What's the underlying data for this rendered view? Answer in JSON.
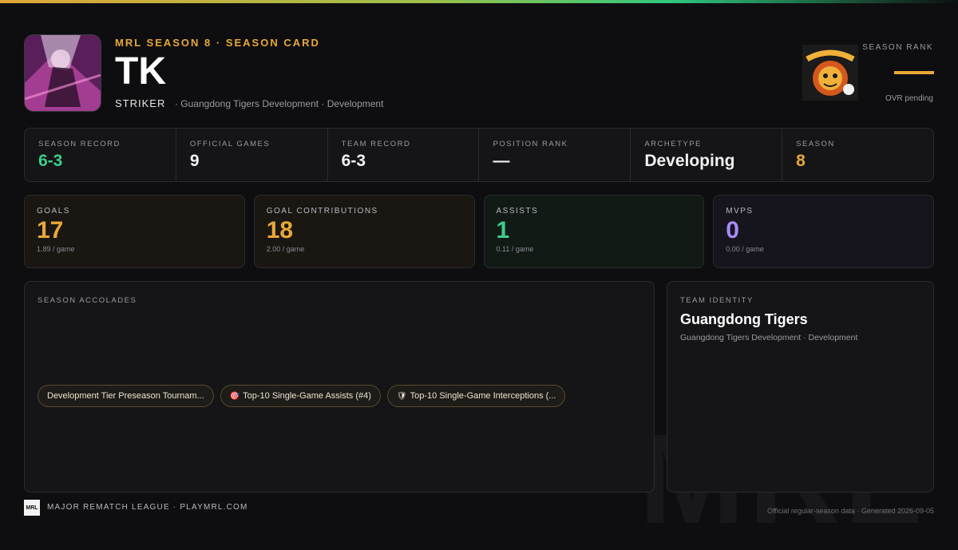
{
  "header": {
    "eyebrow": "MRL SEASON 8 · SEASON CARD",
    "player_name": "TK",
    "position": "STRIKER",
    "team_line": "· Guangdong Tigers Development · Development"
  },
  "rank": {
    "label": "SEASON RANK",
    "ovr_text": "OVR pending",
    "accent_color": "#e8a838"
  },
  "stats": [
    {
      "label": "SEASON RECORD",
      "value": "6-3",
      "color": "#3ccf8a"
    },
    {
      "label": "OFFICIAL GAMES",
      "value": "9",
      "color": "#f2f2f2"
    },
    {
      "label": "TEAM RECORD",
      "value": "6-3",
      "color": "#f2f2f2"
    },
    {
      "label": "POSITION RANK",
      "value": "—",
      "color": "#f2f2f2"
    },
    {
      "label": "ARCHETYPE",
      "value": "Developing",
      "color": "#f2f2f2"
    },
    {
      "label": "SEASON",
      "value": "8",
      "color": "#e8a838"
    }
  ],
  "cards": [
    {
      "label": "GOALS",
      "value": "17",
      "per": "1.89 / game",
      "color": "#e8a838",
      "bg": "#1a1712"
    },
    {
      "label": "GOAL CONTRIBUTIONS",
      "value": "18",
      "per": "2.00 / game",
      "color": "#e8a838",
      "bg": "#1a1712"
    },
    {
      "label": "ASSISTS",
      "value": "1",
      "per": "0.11 / game",
      "color": "#3ccf8a",
      "bg": "#121a16"
    },
    {
      "label": "MVPS",
      "value": "0",
      "per": "0.00 / game",
      "color": "#a78bfa",
      "bg": "#16141c"
    }
  ],
  "accolades": {
    "label": "SEASON ACCOLADES",
    "items": [
      {
        "icon": "",
        "icon_name": "none",
        "text": "Development Tier Preseason Tournam..."
      },
      {
        "icon": "🎯",
        "icon_name": "target-icon",
        "text": "Top-10 Single-Game Assists (#4)"
      },
      {
        "icon": "🛡",
        "icon_name": "shield-icon",
        "text": "Top-10 Single-Game Interceptions (..."
      }
    ]
  },
  "identity": {
    "label": "TEAM IDENTITY",
    "name": "Guangdong Tigers",
    "sub": "Guangdong Tigers Development · Development"
  },
  "footer": {
    "logo_text": "MRL",
    "left": "MAJOR REMATCH LEAGUE · PLAYMRL.COM",
    "right": "Official regular-season data · Generated 2026-09-05"
  },
  "watermark": "MRL"
}
